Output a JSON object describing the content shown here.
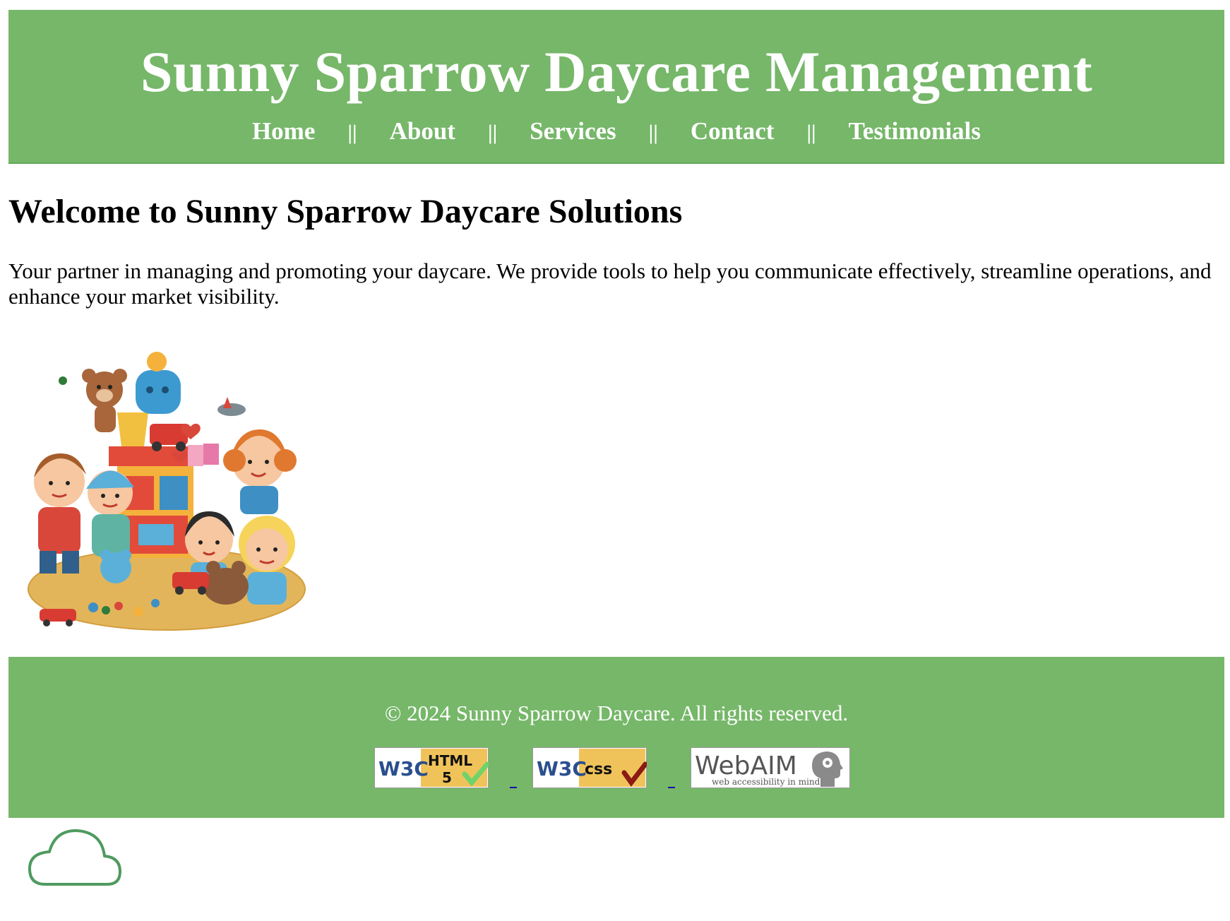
{
  "header": {
    "title": "Sunny Sparrow Daycare Management",
    "nav": {
      "home": "Home",
      "about": "About",
      "services": "Services",
      "contact": "Contact",
      "testimonials": "Testimonials",
      "separator": "||"
    }
  },
  "main": {
    "heading": "Welcome to Sunny Sparrow Daycare Solutions",
    "intro": "Your partner in managing and promoting your daycare. We provide tools to help you communicate effectively, streamline operations, and enhance your market visibility."
  },
  "footer": {
    "copyright": "© 2024 Sunny Sparrow Daycare. All rights reserved.",
    "badges": {
      "html5": {
        "w3c": "W3C",
        "label": "HTML",
        "version": "5"
      },
      "css": {
        "w3c": "W3C",
        "label": "css"
      },
      "webaim": {
        "brand": "WebAIM",
        "tagline": "web accessibility in mind"
      }
    }
  },
  "colors": {
    "header_bg": "#76b769",
    "footer_bg": "#76b769",
    "text_on_green": "#ffffff",
    "cloud_outline": "#4f9a5f"
  },
  "icons": {
    "hero": "children-playing-illustration",
    "cloud": "cloud-outline-icon"
  }
}
